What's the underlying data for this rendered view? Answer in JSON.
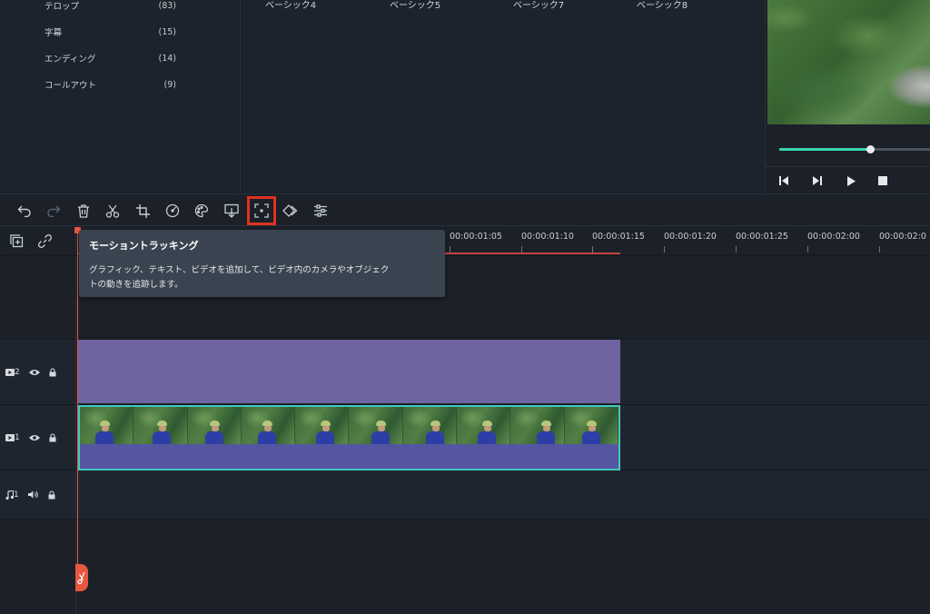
{
  "categories": [
    {
      "label": "テロップ",
      "count": "(83)"
    },
    {
      "label": "字幕",
      "count": "(15)"
    },
    {
      "label": "エンディング",
      "count": "(14)"
    },
    {
      "label": "コールアウト",
      "count": "(9)"
    }
  ],
  "presets": [
    "ベーシック4",
    "ベーシック5",
    "ベーシック7",
    "ベーシック8"
  ],
  "preview": {
    "progress": 0.6,
    "controls": {
      "prev_frame": "previous-frame-icon",
      "next_frame": "next-frame-icon",
      "play": "play-icon",
      "stop": "stop-icon"
    }
  },
  "toolbar": {
    "items": [
      {
        "icon": "undo-icon",
        "state": "enabled"
      },
      {
        "icon": "redo-icon",
        "state": "disabled"
      },
      {
        "icon": "delete-icon",
        "state": "enabled"
      },
      {
        "icon": "cut-icon",
        "state": "enabled"
      },
      {
        "icon": "crop-icon",
        "state": "enabled"
      },
      {
        "icon": "speed-icon",
        "state": "enabled"
      },
      {
        "icon": "color-icon",
        "state": "enabled"
      },
      {
        "icon": "export-frame-icon",
        "state": "enabled"
      },
      {
        "icon": "motion-tracking-icon",
        "state": "active"
      },
      {
        "icon": "keyframe-icon",
        "state": "enabled"
      },
      {
        "icon": "settings-sliders-icon",
        "state": "enabled"
      }
    ]
  },
  "tooltip": {
    "title": "モーショントラッキング",
    "line1": "グラフィック、テキスト、ビデオを追加して、ビデオ内のカメラやオブジェク",
    "line2": "トの動きを追跡します。"
  },
  "ruler": {
    "labels": [
      "00:00:01:05",
      "00:00:01:10",
      "00:00:01:15",
      "00:00:01:20",
      "00:00:01:25",
      "00:00:02:00",
      "00:00:02:0"
    ]
  },
  "tracks": [
    {
      "icon": "video-track-icon",
      "number": "2"
    },
    {
      "icon": "video-track-icon",
      "number": "1"
    },
    {
      "icon": "audio-track-icon",
      "number": "1"
    }
  ],
  "colors": {
    "accent": "#3ed6b0",
    "playhead": "#e8573f",
    "highlight": "#e0321e",
    "title_clip": "#6f64a0",
    "video_clip": "#5655a1",
    "video_clip_border": "#40c9c0"
  }
}
